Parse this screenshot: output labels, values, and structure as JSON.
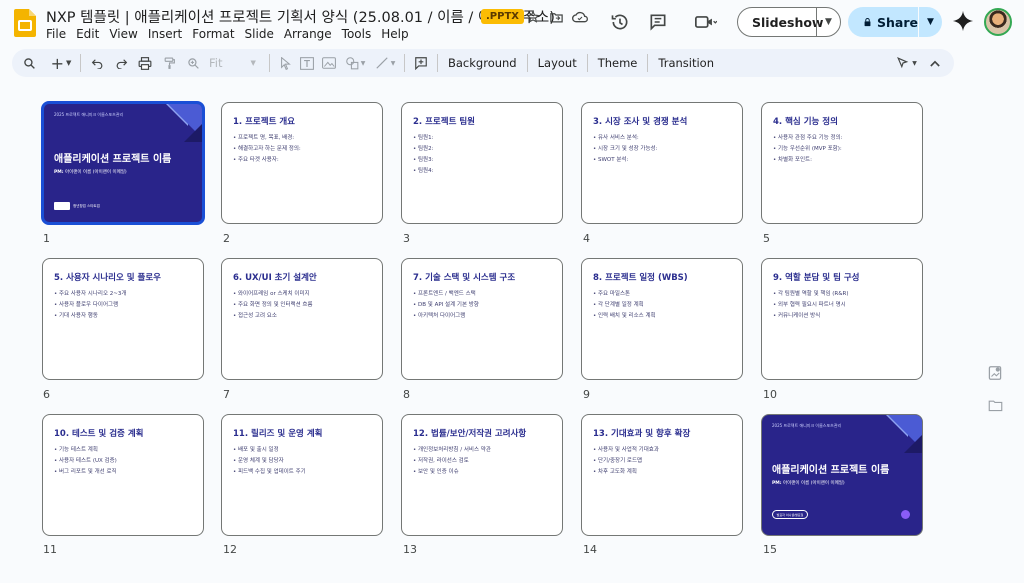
{
  "doc": {
    "title": "NXP 템플릿 | 애플리케이션 프로젝트 기획서 양식 (25.08.01 / 이름 / 이메일 주소)",
    "format_badge": ".PPTX"
  },
  "menu": [
    "File",
    "Edit",
    "View",
    "Insert",
    "Format",
    "Slide",
    "Arrange",
    "Tools",
    "Help"
  ],
  "header": {
    "slideshow_label": "Slideshow",
    "share_label": "Share"
  },
  "toolbar": {
    "fit_label": "Fit",
    "background_label": "Background",
    "layout_label": "Layout",
    "theme_label": "Theme",
    "transition_label": "Transition"
  },
  "cover": {
    "small_text": "2025 프로젝트 애니미크 이름스포츠관리",
    "title": "애플리케이션 프로젝트 이름",
    "pm_label": "PM:",
    "pm_value": "아이랜이 이름 (아이랜이 이메일)",
    "org_text": "청년창업 스타트업",
    "pill_text": "발표자 이니셜/발표일"
  },
  "slides": [
    {
      "num": "1"
    },
    {
      "num": "2",
      "title": "1. 프로젝트 개요",
      "bullets": [
        "프로젝트 명, 목표, 배경:",
        "해결하고자 하는 문제 정의:",
        "주요 타겟 사용자:"
      ]
    },
    {
      "num": "3",
      "title": "2. 프로젝트 팀원",
      "bullets": [
        "팀원1:",
        "팀원2:",
        "팀원3:",
        "팀원4:"
      ]
    },
    {
      "num": "4",
      "title": "3. 시장 조사 및 경쟁 분석",
      "bullets": [
        "유사 서비스 분석:",
        "시장 크기 및 성장 가능성:",
        "SWOT 분석:"
      ]
    },
    {
      "num": "5",
      "title": "4. 핵심 기능 정의",
      "bullets": [
        "사용자 관점 주요 기능 정의:",
        "기능 우선순위 (MVP 포함):",
        "차별화 포인트:"
      ]
    },
    {
      "num": "6",
      "title": "5. 사용자 시나리오 및 플로우",
      "bullets": [
        "주요 사용자 시나리오 2~3개",
        "사용자 플로우 다이어그램",
        "기대 사용자 행동"
      ]
    },
    {
      "num": "7",
      "title": "6. UX/UI 초기 설계안",
      "bullets": [
        "와이어프레임 or 스케치 이미지",
        "주요 화면 정의 및 인터랙션 흐름",
        "접근성 고려 요소"
      ]
    },
    {
      "num": "8",
      "title": "7. 기술 스택 및 시스템 구조",
      "bullets": [
        "프론트엔드 / 백엔드 스택",
        "DB 및 API 설계 기본 방향",
        "아키텍처 다이어그램"
      ]
    },
    {
      "num": "9",
      "title": "8. 프로젝트 일정 (WBS)",
      "bullets": [
        "주요 마일스톤",
        "각 단계별 일정 계획",
        "인력 배치 및 리소스 계획"
      ]
    },
    {
      "num": "10",
      "title": "9. 역할 분담 및 팀 구성",
      "bullets": [
        "각 팀원별 역할 및 책임 (R&R)",
        "외부 협력 필요시 파트너 명시",
        "커뮤니케이션 방식"
      ]
    },
    {
      "num": "11",
      "title": "10. 테스트 및 검증 계획",
      "bullets": [
        "기능 테스트 계획",
        "사용자 테스트 (UX 검증)",
        "버그 리포트 및 개선 로직"
      ]
    },
    {
      "num": "12",
      "title": "11. 릴리즈 및 운영 계획",
      "bullets": [
        "배포 및 출시 일정",
        "운영 체계 및 담당자",
        "피드백 수집 및 업데이트 주기"
      ]
    },
    {
      "num": "13",
      "title": "12. 법률/보안/저작권 고려사항",
      "bullets": [
        "개인정보처리방침 / 서비스 약관",
        "저작권, 라이선스 검토",
        "보안 및 인증 이슈"
      ]
    },
    {
      "num": "14",
      "title": "13. 기대효과 및 향후 확장",
      "bullets": [
        "사용자 및 사업적 기대효과",
        "단기/중장기 로드맵",
        "차후 고도화 계획"
      ]
    },
    {
      "num": "15"
    }
  ]
}
